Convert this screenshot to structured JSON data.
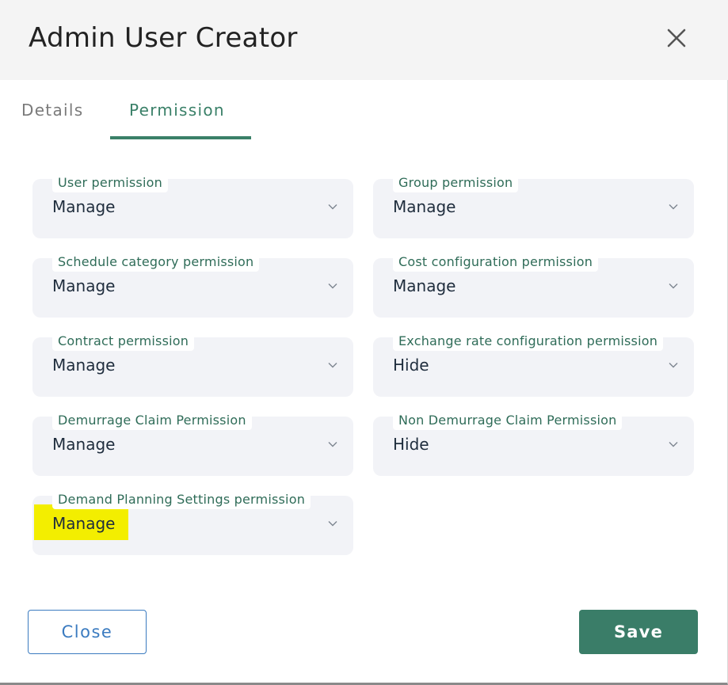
{
  "dialog": {
    "title": "Admin User Creator",
    "close_icon": "close-icon"
  },
  "tabs": [
    {
      "label": "Details",
      "active": false
    },
    {
      "label": "Permission",
      "active": true
    }
  ],
  "permissions": [
    {
      "label": "User permission",
      "value": "Manage"
    },
    {
      "label": "Group permission",
      "value": "Manage"
    },
    {
      "label": "Schedule category permission",
      "value": "Manage"
    },
    {
      "label": "Cost configuration permission",
      "value": "Manage"
    },
    {
      "label": "Contract permission",
      "value": "Manage"
    },
    {
      "label": "Exchange rate configuration permission",
      "value": "Hide"
    },
    {
      "label": "Demurrage Claim Permission",
      "value": "Manage"
    },
    {
      "label": "Non Demurrage Claim Permission",
      "value": "Hide"
    },
    {
      "label": "Demand Planning Settings permission",
      "value": "Manage",
      "highlighted": true
    }
  ],
  "footer": {
    "close_label": "Close",
    "save_label": "Save"
  },
  "colors": {
    "accent_green": "#3a7d68",
    "close_blue": "#3b7bc0",
    "highlight": "#f3ee00",
    "field_bg": "#f2f3f7"
  }
}
